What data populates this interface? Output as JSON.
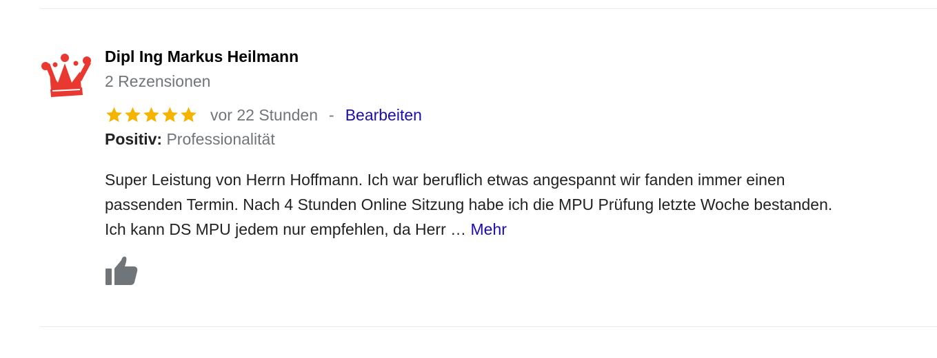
{
  "review": {
    "reviewer_name": "Dipl Ing Markus Heilmann",
    "review_count": "2 Rezensionen",
    "rating": 5,
    "rating_max": 5,
    "time_ago": "vor 22 Stunden",
    "separator": "-",
    "edit_label": "Bearbeiten",
    "positive_label": "Positiv:",
    "positive_value": "Professionalität",
    "text_lines": [
      "Super Leistung von Herrn Hoffmann. Ich war beruflich etwas angespannt wir fanden immer einen",
      "passenden Termin. Nach 4 Stunden Online Sitzung habe ich die MPU Prüfung letzte Woche bestanden.",
      "Ich kann DS MPU jedem nur empfehlen, da Herr …"
    ],
    "more_label": "Mehr"
  },
  "icons": {
    "avatar": "crown-icon",
    "star": "star-icon",
    "like": "thumbs-up-icon"
  },
  "colors": {
    "star": "#f4b400",
    "link": "#1a0dab",
    "muted": "#70757a",
    "crown": "#e8382f",
    "like": "#70757a"
  }
}
